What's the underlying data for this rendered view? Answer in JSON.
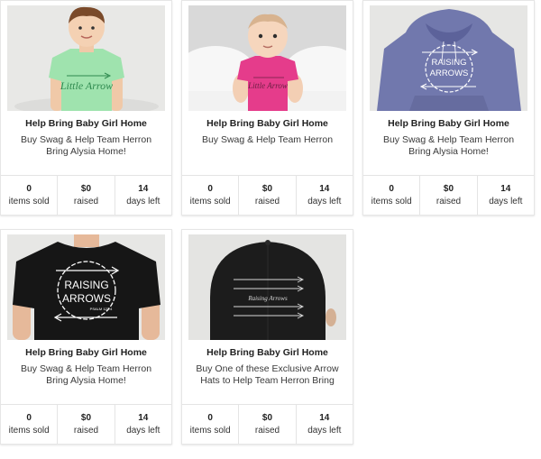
{
  "campaigns": [
    {
      "image": "kid-mint-tshirt",
      "image_text": "Little Arrow",
      "title": "Help Bring Baby Girl Home",
      "desc_line1": "Buy Swag & Help Team Herron",
      "desc_line2": "Bring Alysia Home!",
      "items_sold": "0",
      "items_sold_label": "items sold",
      "raised": "$0",
      "raised_label": "raised",
      "days_left": "14",
      "days_left_label": "days left"
    },
    {
      "image": "baby-pink-onesie",
      "image_text": "Little Arrow",
      "title": "Help Bring Baby Girl Home",
      "desc_line1": "Buy Swag & Help Team Herron",
      "desc_line2": "",
      "items_sold": "0",
      "items_sold_label": "items sold",
      "raised": "$0",
      "raised_label": "raised",
      "days_left": "14",
      "days_left_label": "days left"
    },
    {
      "image": "blue-hoodie",
      "image_text_1": "RAISING",
      "image_text_2": "ARROWS",
      "title": "Help Bring Baby Girl Home",
      "desc_line1": "Buy Swag & Help Team Herron",
      "desc_line2": "Bring Alysia Home!",
      "items_sold": "0",
      "items_sold_label": "items sold",
      "raised": "$0",
      "raised_label": "raised",
      "days_left": "14",
      "days_left_label": "days left"
    },
    {
      "image": "black-tshirt",
      "image_text_1": "RAISING",
      "image_text_2": "ARROWS",
      "image_text_3": "PSALM 127:4",
      "title": "Help Bring Baby Girl Home",
      "desc_line1": "Buy Swag & Help Team Herron",
      "desc_line2": "Bring Alysia Home!",
      "items_sold": "0",
      "items_sold_label": "items sold",
      "raised": "$0",
      "raised_label": "raised",
      "days_left": "14",
      "days_left_label": "days left"
    },
    {
      "image": "black-arrow-hat",
      "image_text": "Raising Arrows",
      "title": "Help Bring Baby Girl Home",
      "desc_line1": "Buy One of these Exclusive Arrow",
      "desc_line2": "Hats to Help Team Herron Bring",
      "items_sold": "0",
      "items_sold_label": "items sold",
      "raised": "$0",
      "raised_label": "raised",
      "days_left": "14",
      "days_left_label": "days left"
    }
  ]
}
